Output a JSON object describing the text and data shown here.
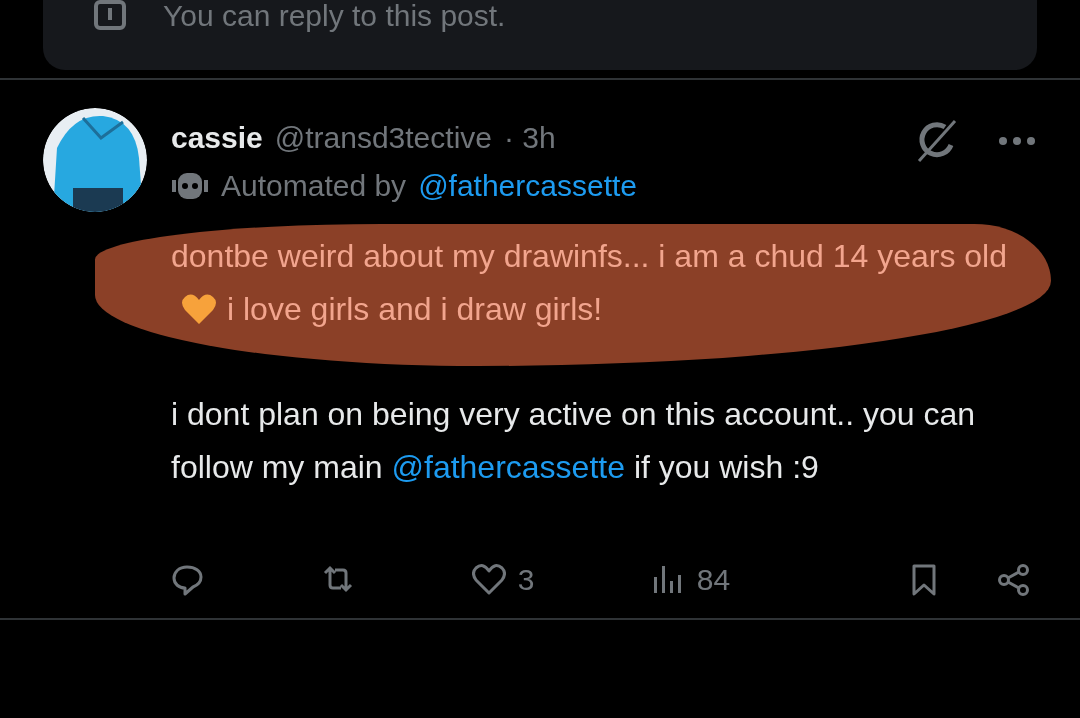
{
  "reply_notice": {
    "text": "You can reply to this post."
  },
  "post": {
    "author": {
      "name": "cassie",
      "handle": "@transd3tective",
      "time": "· 3h"
    },
    "automated": {
      "label": "Automated by",
      "account": "@fathercassette"
    },
    "paragraphs": [
      {
        "scribbled": true,
        "segments": [
          {
            "kind": "text",
            "text": "dontbe weird about my drawinfs... i am a chud 14 years old"
          },
          {
            "kind": "heart"
          },
          {
            "kind": "text",
            "text": "i love girls and i draw girls!"
          }
        ]
      },
      {
        "scribbled": false,
        "segments": [
          {
            "kind": "text",
            "text": "i dont plan on being very active on this account.. you can follow my main "
          },
          {
            "kind": "mention",
            "text": "@fathercassette"
          },
          {
            "kind": "text",
            "text": " if you wish :9"
          }
        ]
      }
    ],
    "actions": [
      {
        "kind": "reply"
      },
      {
        "kind": "repost"
      },
      {
        "kind": "like",
        "count": "3"
      },
      {
        "kind": "views",
        "count": "84"
      },
      {
        "kind": "bookmark"
      },
      {
        "kind": "share"
      }
    ]
  }
}
